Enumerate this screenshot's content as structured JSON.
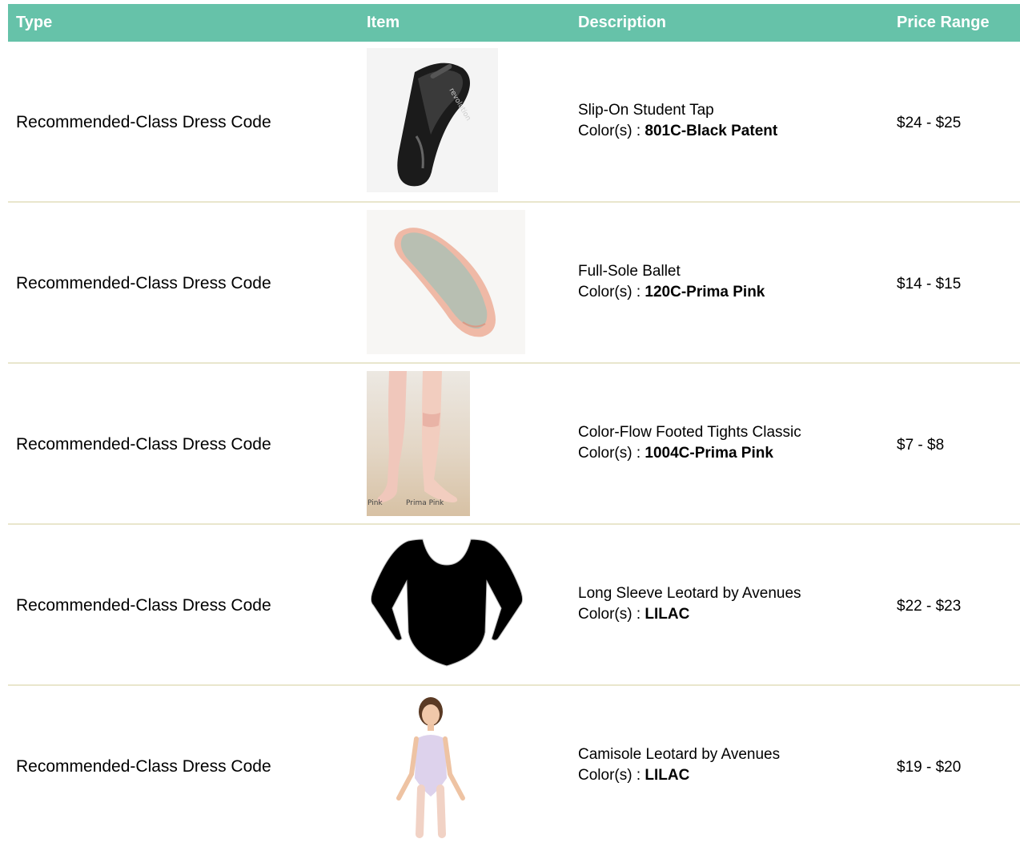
{
  "headers": {
    "type": "Type",
    "item": "Item",
    "description": "Description",
    "price": "Price Range"
  },
  "rows": [
    {
      "type": "Recommended-Class Dress Code",
      "name": "Slip-On Student Tap",
      "color_prefix": "Color(s) : ",
      "color": "801C-Black Patent",
      "price": "$24 - $25",
      "image": "black-patent-tap-shoe"
    },
    {
      "type": "Recommended-Class Dress Code",
      "name": "Full-Sole Ballet",
      "color_prefix": "Color(s) : ",
      "color": "120C-Prima Pink",
      "price": "$14 - $15",
      "image": "pink-ballet-slipper"
    },
    {
      "type": "Recommended-Class Dress Code",
      "name": "Color-Flow Footed Tights Classic",
      "color_prefix": "Color(s) : ",
      "color": "1004C-Prima Pink",
      "price": "$7 - $8",
      "image": "footed-tights-photo",
      "image_captions": [
        "Pink",
        "Prima Pink"
      ]
    },
    {
      "type": "Recommended-Class Dress Code",
      "name": "Long Sleeve Leotard by Avenues",
      "color_prefix": "Color(s) : ",
      "color": "LILAC",
      "price": "$22 - $23",
      "image": "black-long-sleeve-leotard"
    },
    {
      "type": "Recommended-Class Dress Code",
      "name": "Camisole Leotard by Avenues",
      "color_prefix": "Color(s) : ",
      "color": "LILAC",
      "price": "$19 - $20",
      "image": "girl-in-lilac-camisole-leotard"
    }
  ],
  "colors": {
    "header_bg": "#66c2a9",
    "header_text": "#ffffff",
    "row_divider": "#e9e6cd"
  }
}
